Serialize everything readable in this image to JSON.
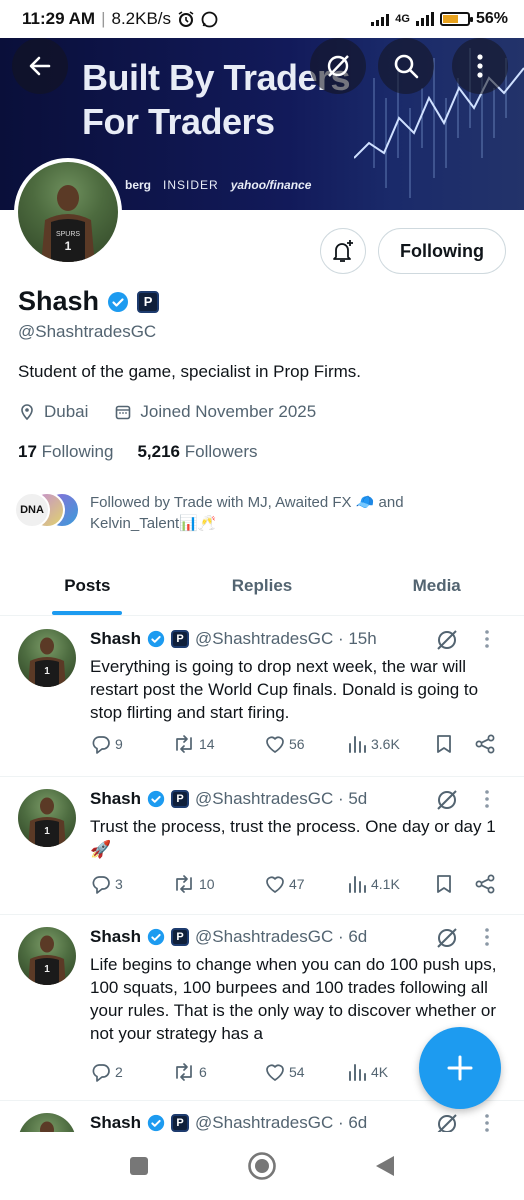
{
  "status_bar": {
    "time": "11:29 AM",
    "net_speed": "8.2KB/s",
    "network": "4G",
    "battery": "56%",
    "battery_level": 0.56
  },
  "banner": {
    "headline_line1": "Built By Traders",
    "headline_line2": "For Traders",
    "logos": [
      "berg",
      "INSIDER",
      "yahoo/finance"
    ]
  },
  "header": {
    "back_icon": "arrow-left-icon",
    "grok_icon": "grok-icon",
    "search_icon": "search-icon",
    "more_icon": "more-vertical-icon"
  },
  "profile": {
    "name": "Shash",
    "handle": "@ShashtradesGC",
    "bio": "Student of the game, specialist in Prop Firms.",
    "location": "Dubai",
    "joined": "Joined November 2025",
    "following_count": "17",
    "following_label": "Following",
    "followers_count": "5,216",
    "followers_label": "Followers",
    "follow_button": "Following",
    "followed_by_line1": "Followed by Trade with MJ, Awaited FX 🧢 and",
    "followed_by_line2": "Kelvin_Talent📊🥂"
  },
  "tabs": [
    {
      "label": "Posts",
      "active": true
    },
    {
      "label": "Replies",
      "active": false
    },
    {
      "label": "Media",
      "active": false
    }
  ],
  "posts": [
    {
      "name": "Shash",
      "handle_time": "@ShashtradesGC · 15h",
      "text": "Everything is going to drop next week, the war will restart post the World Cup finals. Donald is going to stop flirting and start firing.",
      "replies": "9",
      "reposts": "14",
      "likes": "56",
      "views": "3.6K"
    },
    {
      "name": "Shash",
      "handle_time": "@ShashtradesGC · 5d",
      "text": "Trust the process, trust the process. One day or day 1🚀",
      "replies": "3",
      "reposts": "10",
      "likes": "47",
      "views": "4.1K"
    },
    {
      "name": "Shash",
      "handle_time": "@ShashtradesGC · 6d",
      "text": "Life begins to change when you can do 100 push ups, 100 squats, 100 burpees and 100 trades following all your rules. That is the only way to discover whether or not your strategy has a",
      "replies": "2",
      "reposts": "6",
      "likes": "54",
      "views": "4K"
    },
    {
      "name": "Shash",
      "handle_time": "@ShashtradesGC · 6d",
      "text": "",
      "replies": "",
      "reposts": "",
      "likes": "",
      "views": ""
    }
  ],
  "fab_icon": "plus-icon",
  "navbar": [
    "recents-icon",
    "home-icon",
    "back-triangle-icon"
  ]
}
